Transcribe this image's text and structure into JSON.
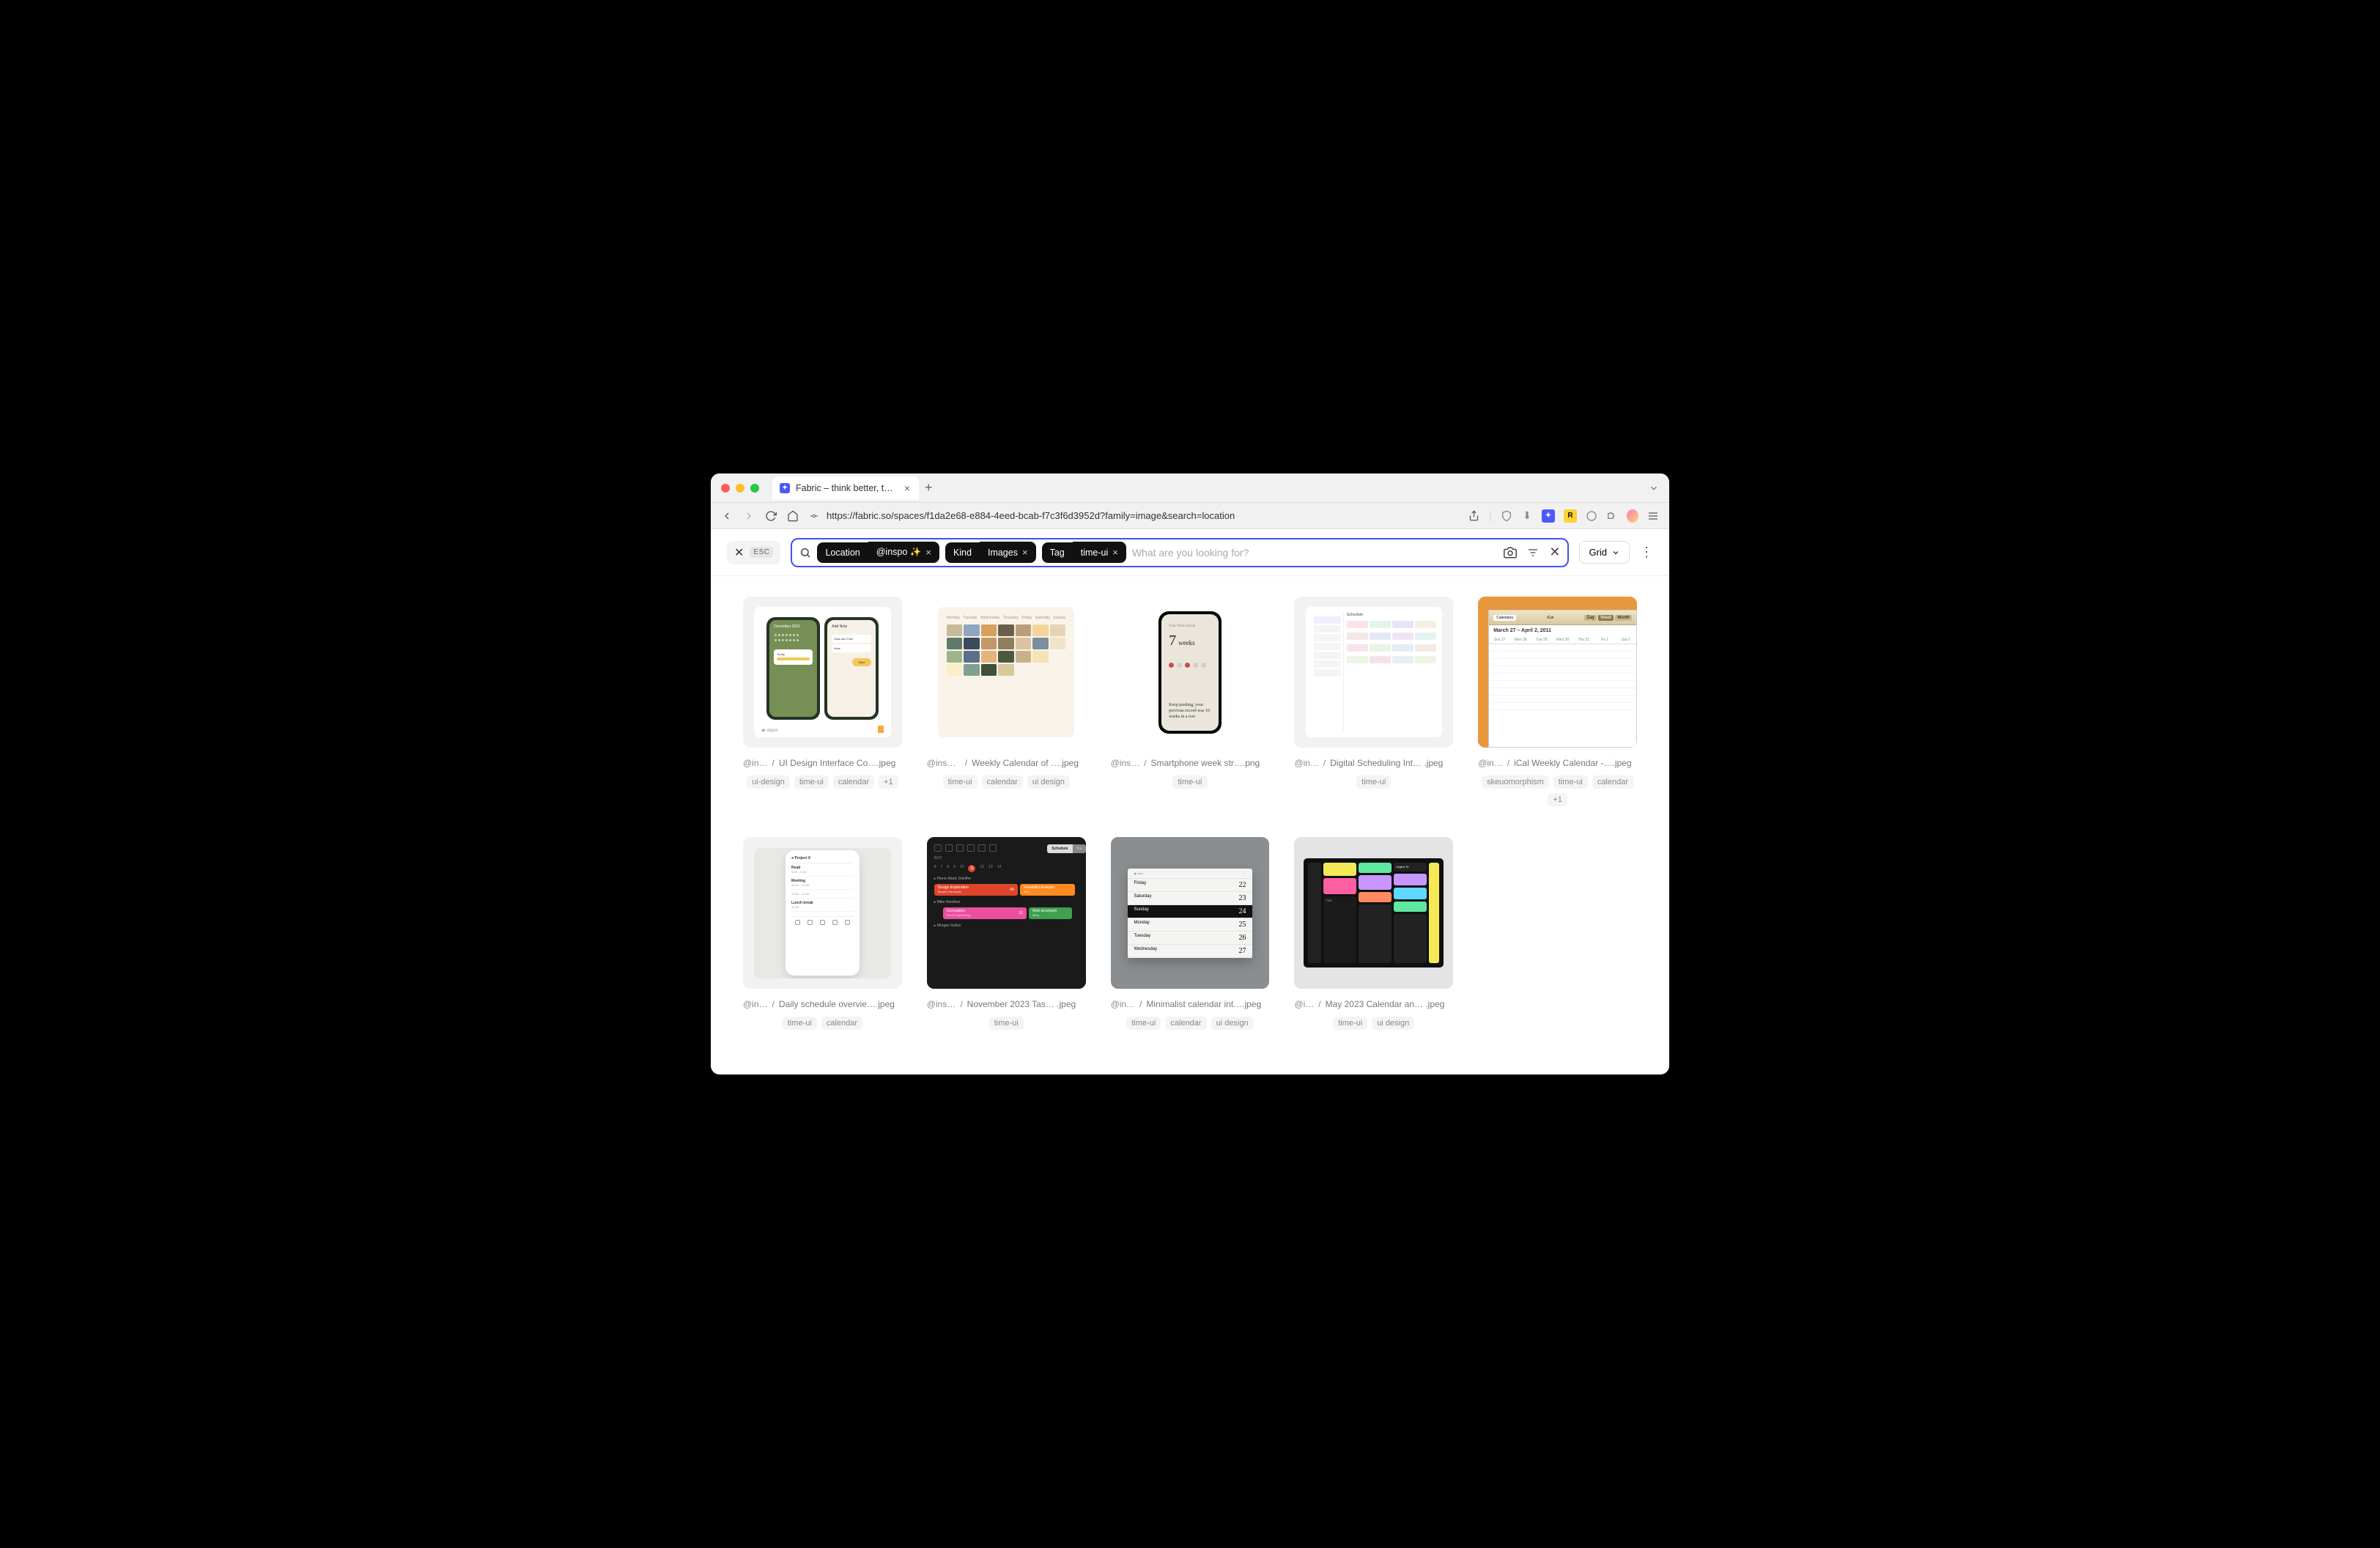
{
  "browser": {
    "tab_title": "Fabric – think better, togethe",
    "url": "https://fabric.so/spaces/f1da2e68-e884-4eed-bcab-f7c3f6d3952d?family=image&search=location"
  },
  "search": {
    "esc_label": "ESC",
    "placeholder": "What are you looking for?",
    "chips": [
      {
        "group": 0,
        "kind": "Location",
        "value": "@inspo ✨"
      },
      {
        "group": 1,
        "kind": "Kind",
        "value": "Images"
      },
      {
        "group": 2,
        "kind": "Tag",
        "value": "time-ui"
      }
    ],
    "view_label": "Grid"
  },
  "items": [
    {
      "source": "@in…",
      "filename": "UI Design Interface Co….jpeg",
      "tags": [
        "ui-design",
        "time-ui",
        "calendar",
        "+1"
      ]
    },
    {
      "source": "@insp…",
      "filename": "Weekly Calendar of ….jpeg",
      "tags": [
        "time-ui",
        "calendar",
        "ui design"
      ]
    },
    {
      "source": "@ins…",
      "filename": "Smartphone week str….png",
      "tags": [
        "time-ui"
      ]
    },
    {
      "source": "@in…",
      "filename": "Digital Scheduling Int… .jpeg",
      "tags": [
        "time-ui"
      ]
    },
    {
      "source": "@in…",
      "filename": "iCal Weekly Calendar -….jpeg",
      "tags": [
        "skeuomorphism",
        "time-ui",
        "calendar",
        "+1"
      ]
    },
    {
      "source": "@in…",
      "filename": "Daily schedule overvie….jpeg",
      "tags": [
        "time-ui",
        "calendar"
      ]
    },
    {
      "source": "@ins…",
      "filename": "November 2023 Tas… .jpeg",
      "tags": [
        "time-ui"
      ]
    },
    {
      "source": "@in…",
      "filename": "Minimalist calendar int….jpeg",
      "tags": [
        "time-ui",
        "calendar",
        "ui design"
      ]
    },
    {
      "source": "@i…",
      "filename": "May 2023 Calendar an… .jpeg",
      "tags": [
        "time-ui",
        "ui design"
      ]
    }
  ],
  "thumbs": {
    "c2_days": [
      "Monday",
      "Tuesday",
      "Wednesday",
      "Thursday",
      "Friday",
      "Saturday",
      "Sunday"
    ],
    "c3_number": "7",
    "c3_unit": "weeks",
    "c3_msg": "Keep pushing, your previous record was 10 weeks in a row",
    "c5_date": "March 27 – April 2, 2011",
    "c5_days": [
      "Sun 27",
      "Mon 28",
      "Tue 29",
      "Wed 30",
      "Thu 31",
      "Fri 1",
      "Sat 2"
    ],
    "c6_title": "Project X",
    "c6_items": [
      {
        "t": "Read",
        "s": "9:00 – 9:30"
      },
      {
        "t": "Meeting",
        "s": "10:00 – 11:00"
      },
      {
        "t": "",
        "s": "11:00 – 12:00"
      },
      {
        "t": "Lunch break",
        "s": "12:30"
      }
    ],
    "c7_month": "NOV",
    "c7_days": [
      "6",
      "7",
      "8",
      "9",
      "10",
      "11",
      "12",
      "13",
      "14"
    ],
    "c7_tab1": "Schedule",
    "c7_tab2": "Tea",
    "c7_person1": "Pierre-Marie Deloffre",
    "c7_bar1": "Design Exploration",
    "c7_bar1_sub": "Musée Carnavalet",
    "c7_bar1_n": "40",
    "c7_bar2": "Feasibility Analysis",
    "c7_bar2_n": "15.5",
    "c7_person2": "Mike Hamilton",
    "c7_bar3": "Conception",
    "c7_bar3_sub": "Feine Engineering",
    "c7_bar3_n": "32",
    "c7_bar4": "Web developm",
    "c7_bar4_sub": "Infisy",
    "c7_person3": "Morgan Sutton",
    "c8_rows": [
      {
        "d": "Friday",
        "n": "22"
      },
      {
        "d": "Saturday",
        "n": "23"
      },
      {
        "d": "Sunday",
        "n": "24"
      },
      {
        "d": "Monday",
        "n": "25"
      },
      {
        "d": "Tuesday",
        "n": "26"
      },
      {
        "d": "Wednesday",
        "n": "27"
      }
    ]
  }
}
